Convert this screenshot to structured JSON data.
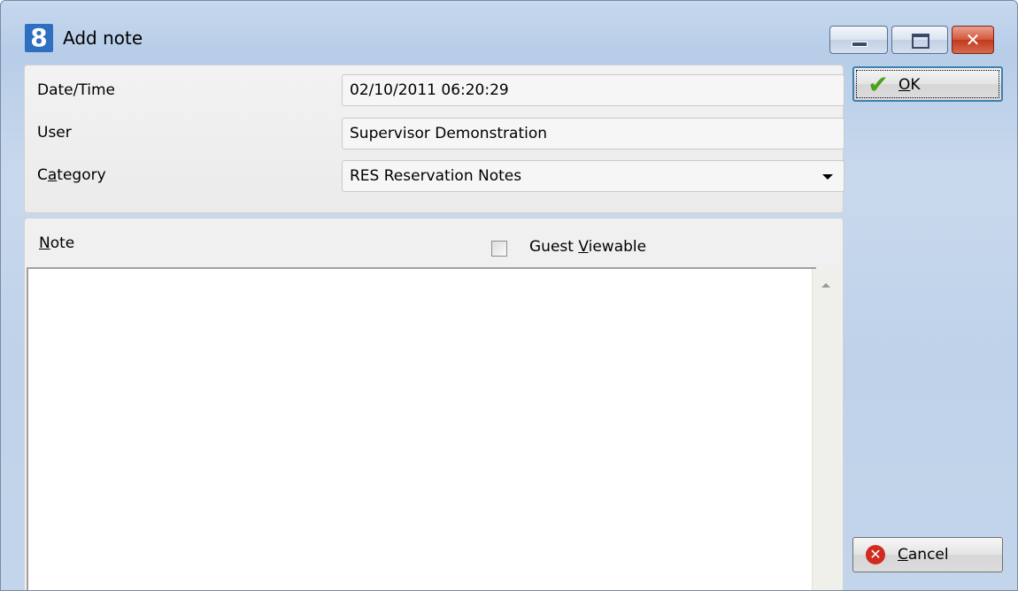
{
  "window": {
    "title": "Add note",
    "app_icon": "8",
    "controls": {
      "minimize": "minimize-icon",
      "maximize": "maximize-icon",
      "close": "close-icon"
    }
  },
  "fields": {
    "datetime": {
      "label": "Date/Time",
      "value": "02/10/2011 06:20:29"
    },
    "user": {
      "label": "User",
      "value": "Supervisor Demonstration"
    },
    "category": {
      "label_prefix": "C",
      "label_accel": "a",
      "label_suffix": "tegory",
      "value": "RES Reservation Notes"
    }
  },
  "note": {
    "label_accel": "N",
    "label_rest": "ote",
    "guest_viewable": {
      "prefix": "Guest ",
      "accel": "V",
      "suffix": "iewable",
      "checked": false
    },
    "text": ""
  },
  "buttons": {
    "ok": {
      "accel": "O",
      "rest": "K"
    },
    "cancel": {
      "accel": "C",
      "rest": "ancel"
    }
  }
}
